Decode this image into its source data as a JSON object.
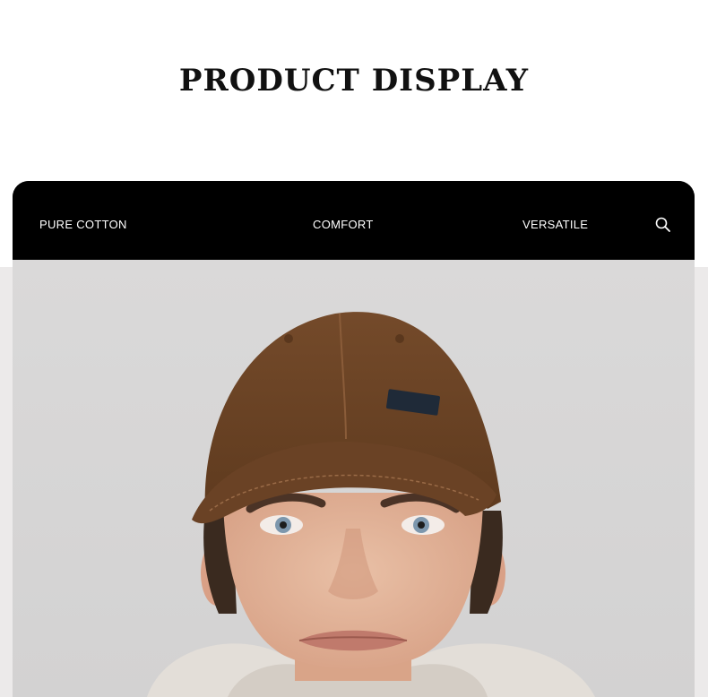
{
  "heading": "PRODUCT DISPLAY",
  "nav": {
    "items": [
      "PURE COTTON",
      "COMFORT",
      "VERSATILE"
    ],
    "search_icon": "search-icon"
  },
  "photo": {
    "subject": "model-wearing-brown-baseball-cap",
    "colors": {
      "cap": "#6b4426",
      "background": "#d8d7d7",
      "hood": "#e4e0db"
    }
  }
}
